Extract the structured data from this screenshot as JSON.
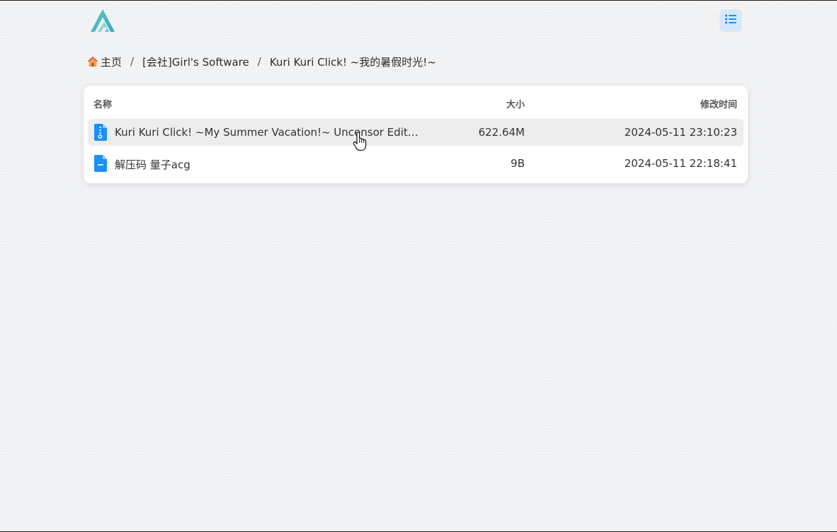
{
  "breadcrumb": {
    "home": "主页",
    "separator": "/",
    "items": [
      "[会社]Girl's Software",
      "Kuri Kuri Click! ~我的暑假时光!~"
    ]
  },
  "table": {
    "headers": {
      "name": "名称",
      "size": "大小",
      "modified": "修改时间"
    },
    "rows": [
      {
        "name": "Kuri Kuri Click! ~My Summer Vacation!~ Uncensor Edition...",
        "size": "622.64M",
        "modified": "2024-05-11 23:10:23",
        "icon": "zip-file-icon"
      },
      {
        "name": "解压码 量子acg",
        "size": "9B",
        "modified": "2024-05-11 22:18:41",
        "icon": "text-file-icon"
      }
    ]
  },
  "colors": {
    "accent": "#1890ff",
    "logo_teal": "#4fc3b8",
    "menu_bg": "#d6e9fb"
  }
}
